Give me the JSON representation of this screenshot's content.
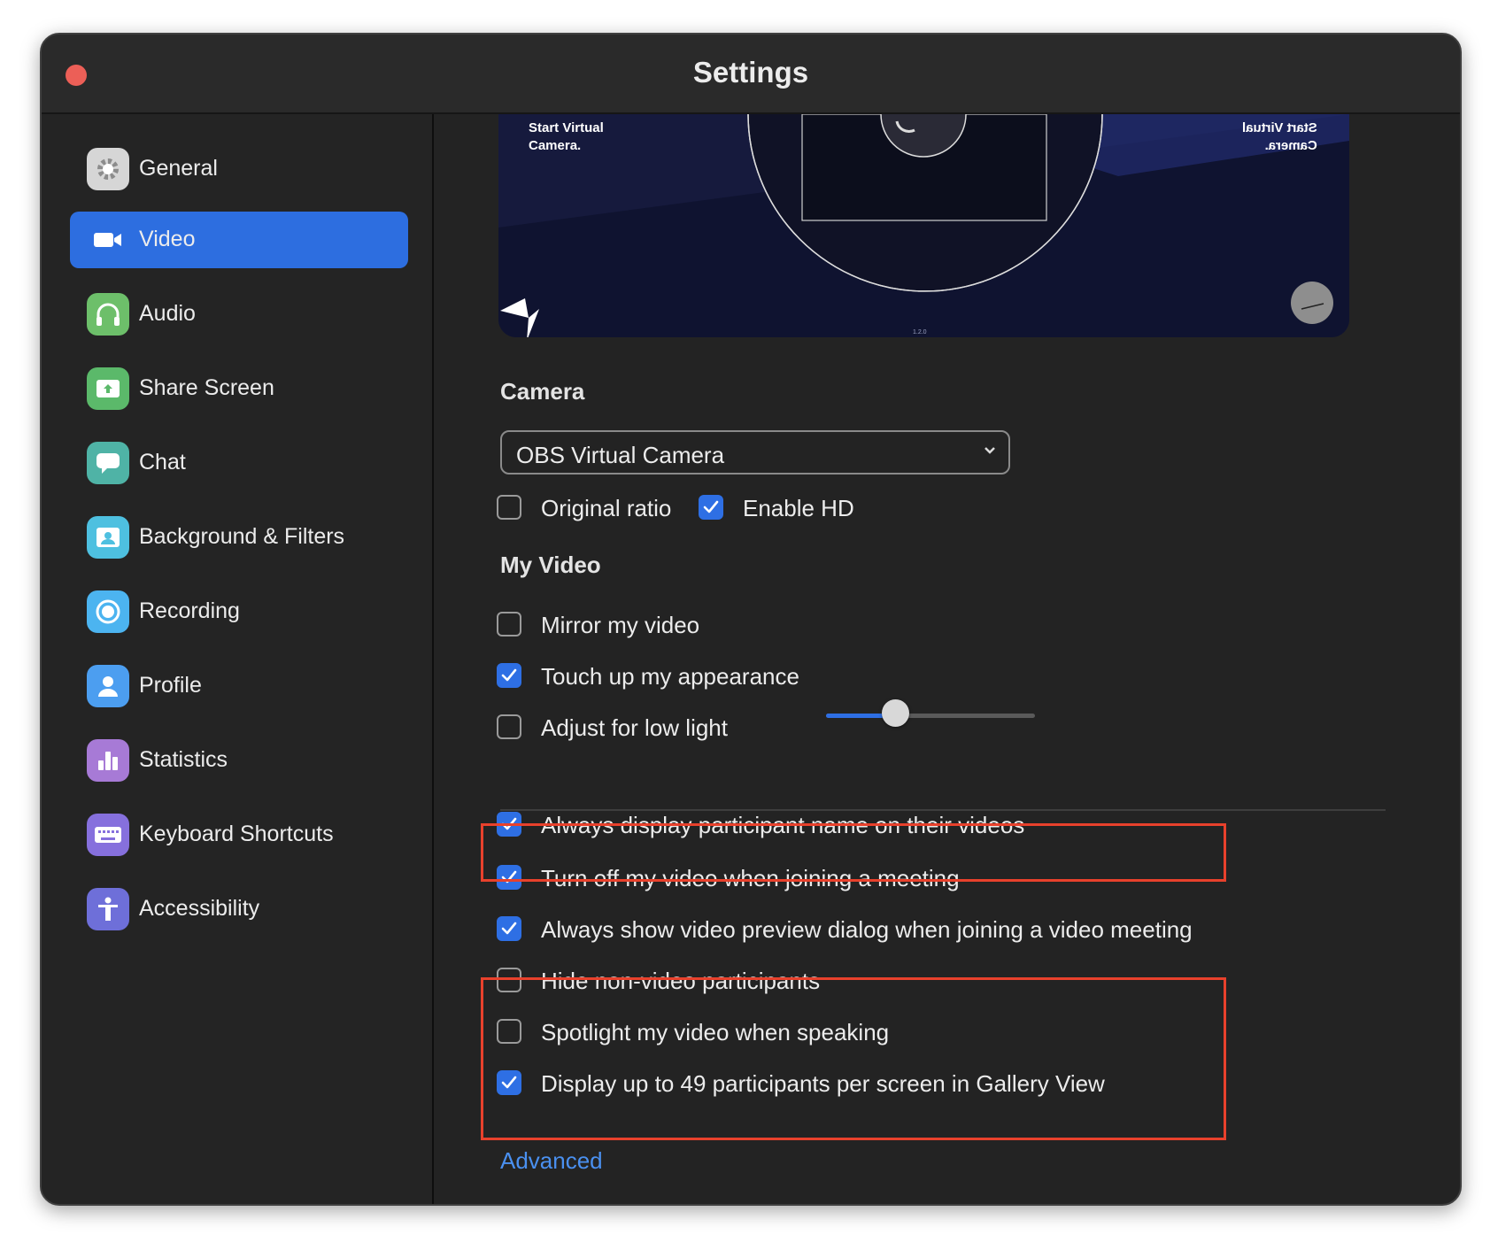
{
  "window": {
    "title": "Settings"
  },
  "sidebar": {
    "items": [
      {
        "label": "General",
        "icon": "gear-icon",
        "color": "#d6d6d6"
      },
      {
        "label": "Video",
        "icon": "video-camera-icon",
        "color": "#2d6ee0",
        "active": true
      },
      {
        "label": "Audio",
        "icon": "headphones-icon",
        "color": "#6dbf6a"
      },
      {
        "label": "Share Screen",
        "icon": "share-screen-icon",
        "color": "#5bb96a"
      },
      {
        "label": "Chat",
        "icon": "chat-bubble-icon",
        "color": "#4fb3a6"
      },
      {
        "label": "Background & Filters",
        "icon": "background-icon",
        "color": "#4ec0e0"
      },
      {
        "label": "Recording",
        "icon": "record-icon",
        "color": "#4cb4f0"
      },
      {
        "label": "Profile",
        "icon": "user-icon",
        "color": "#4c9ef0"
      },
      {
        "label": "Statistics",
        "icon": "bar-chart-icon",
        "color": "#a77ad6"
      },
      {
        "label": "Keyboard Shortcuts",
        "icon": "keyboard-icon",
        "color": "#8670dd"
      },
      {
        "label": "Accessibility",
        "icon": "accessibility-icon",
        "color": "#6e6fd9"
      }
    ]
  },
  "preview": {
    "left_text": "Start Virtual\nCamera.",
    "right_text": "Start Virtual\nCamera.",
    "version": "1.2.0"
  },
  "camera": {
    "heading": "Camera",
    "selected": "OBS Virtual Camera",
    "original_ratio": {
      "label": "Original ratio",
      "checked": false
    },
    "enable_hd": {
      "label": "Enable HD",
      "checked": true
    }
  },
  "my_video": {
    "heading": "My Video",
    "mirror": {
      "label": "Mirror my video",
      "checked": false
    },
    "touch_up": {
      "label": "Touch up my appearance",
      "checked": true,
      "level": 0.33
    },
    "low_light": {
      "label": "Adjust for low light",
      "checked": false
    }
  },
  "options": [
    {
      "label": "Always display participant name on their videos",
      "checked": true
    },
    {
      "label": "Turn off my video when joining a meeting",
      "checked": true
    },
    {
      "label": "Always show video preview dialog when joining a video meeting",
      "checked": true
    },
    {
      "label": "Hide non-video participants",
      "checked": false
    },
    {
      "label": "Spotlight my video when speaking",
      "checked": false
    },
    {
      "label": "Display up to 49 participants per screen in Gallery View",
      "checked": true
    }
  ],
  "advanced_link": "Advanced",
  "colors": {
    "accent": "#2e6fe4",
    "highlight": "#e8412c",
    "link": "#4a90f0"
  }
}
